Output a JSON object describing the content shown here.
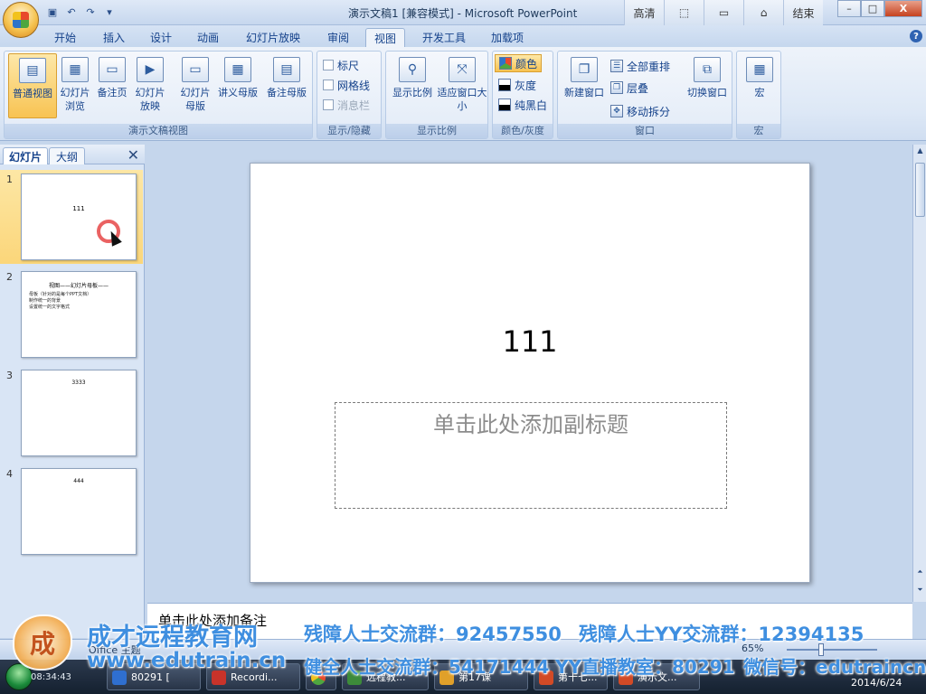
{
  "window": {
    "title": "演示文稿1 [兼容模式] - Microsoft PowerPoint",
    "extra_buttons": [
      "高清",
      "",
      "",
      "",
      "结束"
    ],
    "controls": [
      "–",
      "□",
      "X"
    ]
  },
  "tabs": [
    "开始",
    "插入",
    "设计",
    "动画",
    "幻灯片放映",
    "审阅",
    "视图",
    "开发工具",
    "加载项"
  ],
  "active_tab": "视图",
  "ribbon": {
    "presentation_views": {
      "label": "演示文稿视图",
      "normal": "普通视图",
      "sorter": "幻灯片浏览",
      "notes_page": "备注页",
      "slideshow": "幻灯片放映",
      "slide_master": "幻灯片母版",
      "handout_master": "讲义母版",
      "notes_master": "备注母版"
    },
    "show_hide": {
      "label": "显示/隐藏",
      "ruler": "标尺",
      "gridlines": "网格线",
      "message_bar": "消息栏"
    },
    "zoom": {
      "label": "显示比例",
      "zoom": "显示比例",
      "fit": "适应窗口大小"
    },
    "color": {
      "label": "颜色/灰度",
      "color": "颜色",
      "grayscale": "灰度",
      "bw": "纯黑白"
    },
    "window": {
      "label": "窗口",
      "new_window": "新建窗口",
      "arrange_all": "全部重排",
      "cascade": "层叠",
      "move_split": "移动拆分",
      "switch": "切换窗口"
    },
    "macros": {
      "label": "宏",
      "macro": "宏"
    }
  },
  "panel": {
    "tab_slides": "幻灯片",
    "tab_outline": "大纲",
    "close": "✕",
    "slides": [
      {
        "num": "1",
        "title": "111"
      },
      {
        "num": "2",
        "title": "视图——幻灯片母板——",
        "bullets": [
          "母板（针对的是每个PPT文档）",
          "制作统一的背景",
          "设置统一的文字格式"
        ]
      },
      {
        "num": "3",
        "title": "3333"
      },
      {
        "num": "4",
        "title": "444"
      }
    ]
  },
  "slide": {
    "title": "111",
    "subtitle_placeholder": "单击此处添加副标题"
  },
  "notes": {
    "placeholder": "单击此处添加备注"
  },
  "status": {
    "left": "Office 主题",
    "zoom": "65%"
  },
  "taskbar": {
    "time": "08:34:43",
    "items": [
      "80291 [",
      "Recordi...",
      "",
      "远程教...",
      "第17课",
      "第十七...",
      "演示文..."
    ],
    "date": "2014/6/24"
  },
  "watermark": {
    "logo_char": "成",
    "site_name": "成才远程教育网",
    "url": "www.edutrain.cn",
    "qq_disabled": "残障人士交流群：92457550",
    "yy_disabled": "残障人士YY交流群：12394135",
    "qq_healthy": "健全人士交流群：54171444",
    "yy_live": "YY直播教室：80291",
    "wechat": "微信号：edutraincn"
  }
}
